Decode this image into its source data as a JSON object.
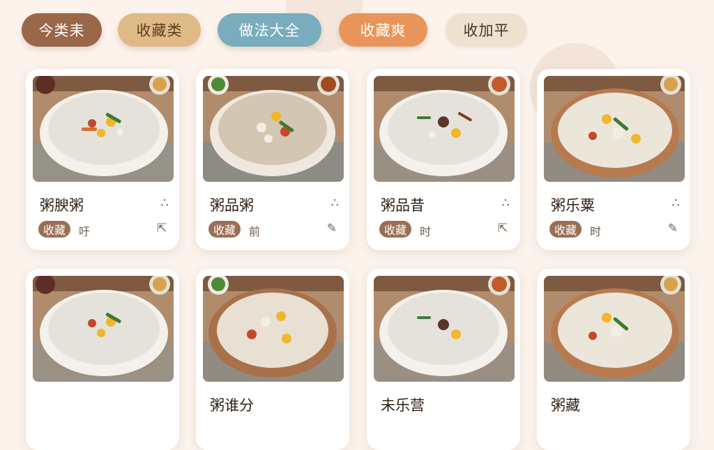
{
  "tabs": [
    "今类耒",
    "收藏类",
    "做法大全",
    "收藏爽",
    "收加平"
  ],
  "cards": [
    {
      "title": "粥腴粥",
      "badge": "收藏",
      "meta": "吁",
      "action_icon": "share-icon"
    },
    {
      "title": "粥品粥",
      "badge": "收藏",
      "meta": "前",
      "action_icon": "edit-icon"
    },
    {
      "title": "粥品昔",
      "badge": "收藏",
      "meta": "时",
      "action_icon": "share-icon"
    },
    {
      "title": "粥乐粟",
      "badge": "收藏",
      "meta": "时",
      "action_icon": "edit-icon"
    },
    {
      "title": "",
      "badge": "",
      "meta": "",
      "action_icon": ""
    },
    {
      "title": "粥谁分",
      "badge": "",
      "meta": "",
      "action_icon": ""
    },
    {
      "title": "未乐营",
      "badge": "",
      "meta": "",
      "action_icon": ""
    },
    {
      "title": "粥藏",
      "badge": "",
      "meta": "",
      "action_icon": ""
    }
  ],
  "colors": {
    "background": "#fbf3ec",
    "tab_brown": "#9a6748",
    "tab_tan": "#dfba86",
    "tab_blue": "#79adbe",
    "tab_orange": "#e9955a",
    "tab_cream": "#efe1d0",
    "badge": "#9a6f56"
  }
}
